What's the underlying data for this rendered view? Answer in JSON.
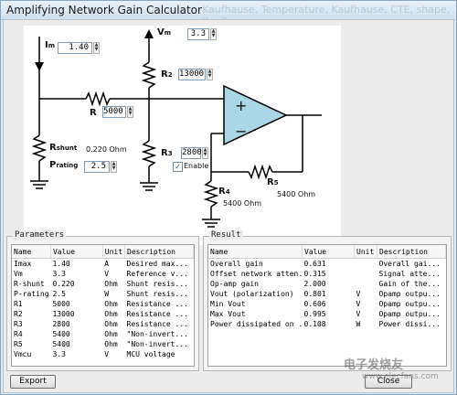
{
  "window": {
    "title": "Amplifying Network Gain Calculator",
    "title_ghost": "Kaufhause, Temperature, Kaufhause, CTE, shape, Kaufhause"
  },
  "schematic": {
    "im_label": "I",
    "im_sub": "m",
    "im_value": "1.40",
    "vm_label": "V",
    "vm_sub": "m",
    "vm_value": "3.3",
    "r1_label": "R",
    "r1_value": "5000",
    "r2_label": "R",
    "r2_sub": "2",
    "r2_value": "13000",
    "r3_label": "R",
    "r3_sub": "3",
    "r3_value": "2800",
    "rshunt_label": "R",
    "rshunt_sub": "shunt",
    "rshunt_value": "0.220 Ohm",
    "prating_label": "P",
    "prating_sub": "rating",
    "prating_value": "2.5",
    "enable_label": "Enable",
    "enable_checked": "✓",
    "r4_label": "R",
    "r4_sub": "4",
    "r4_value": "5400 Ohm",
    "r5_label": "R",
    "r5_sub": "5",
    "r5_value": "5400 Ohm",
    "opamp_plus": "+",
    "opamp_minus": "−",
    "colors": {
      "opamp_fill": "#a9d7e6",
      "wire": "#000000"
    }
  },
  "parameters": {
    "title": "Parameters",
    "headers": [
      "Name",
      "Value",
      "Unit",
      "Description"
    ],
    "rows": [
      [
        "Imax",
        "1.40",
        "A",
        "Desired max..."
      ],
      [
        "Vm",
        "3.3",
        "V",
        "Reference v..."
      ],
      [
        "R-shunt",
        "0.220",
        "Ohm",
        "Shunt resis..."
      ],
      [
        "P-rating",
        "2.5",
        "W",
        "Shunt resis..."
      ],
      [
        "R1",
        "5000",
        "Ohm",
        "Resistance ..."
      ],
      [
        "R2",
        "13000",
        "Ohm",
        "Resistance ..."
      ],
      [
        "R3",
        "2800",
        "Ohm",
        "Resistance ..."
      ],
      [
        "R4",
        "5400",
        "Ohm",
        "\"Non-invert..."
      ],
      [
        "R5",
        "5400",
        "Ohm",
        "\"Non-invert..."
      ],
      [
        "Vmcu",
        "3.3",
        "V",
        "MCU voltage"
      ]
    ]
  },
  "result": {
    "title": "Result",
    "headers": [
      "Name",
      "Value",
      "Unit",
      "Description"
    ],
    "rows": [
      [
        "Overall gain",
        "0.631",
        "",
        "Overall gai..."
      ],
      [
        "Offset network atten...",
        "0.315",
        "",
        "Signal atte..."
      ],
      [
        "Op-amp gain",
        "2.000",
        "",
        "Gain of the..."
      ],
      [
        "Vout (polarization)",
        "0.801",
        "V",
        "Opamp outpu..."
      ],
      [
        "Min Vout",
        "0.606",
        "V",
        "Opamp outpu..."
      ],
      [
        "Max Vout",
        "0.995",
        "V",
        "Opamp outpu..."
      ],
      [
        "Power dissipated on ...",
        "0.108",
        "W",
        "Power dissi..."
      ]
    ]
  },
  "buttons": {
    "export": "Export",
    "close": "Close"
  },
  "watermark": {
    "main": "电子发烧友",
    "url": "www.elecfans.com"
  }
}
